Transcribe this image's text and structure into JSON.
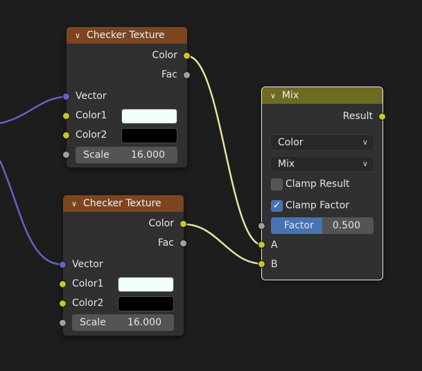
{
  "nodes": {
    "checker1": {
      "title": "Checker Texture",
      "outputs": [
        "Color",
        "Fac"
      ],
      "vector_label": "Vector",
      "color1_label": "Color1",
      "color1_value": "#f0fff9",
      "color2_label": "Color2",
      "color2_value": "#000000",
      "scale_label": "Scale",
      "scale_value": "16.000"
    },
    "checker2": {
      "title": "Checker Texture",
      "outputs": [
        "Color",
        "Fac"
      ],
      "vector_label": "Vector",
      "color1_label": "Color1",
      "color1_value": "#f0fff9",
      "color2_label": "Color2",
      "color2_value": "#000000",
      "scale_label": "Scale",
      "scale_value": "16.000"
    },
    "mix": {
      "title": "Mix",
      "output": "Result",
      "data_type": "Color",
      "blend_mode": "Mix",
      "clamp_result_label": "Clamp Result",
      "clamp_result_checked": false,
      "clamp_factor_label": "Clamp Factor",
      "clamp_factor_checked": true,
      "factor_label": "Factor",
      "factor_value": "0.500",
      "input_a": "A",
      "input_b": "B"
    }
  },
  "colors": {
    "texture_header": "#7c4520",
    "mix_header": "#6c6b1f",
    "color_socket": "#c7c729",
    "float_socket": "#a1a1a1",
    "vector_socket": "#6363c7",
    "accent": "#4772b3"
  },
  "icons": {
    "collapse": "chevron-down-icon",
    "dropdown": "chevron-down-icon",
    "check": "checkmark-icon"
  }
}
